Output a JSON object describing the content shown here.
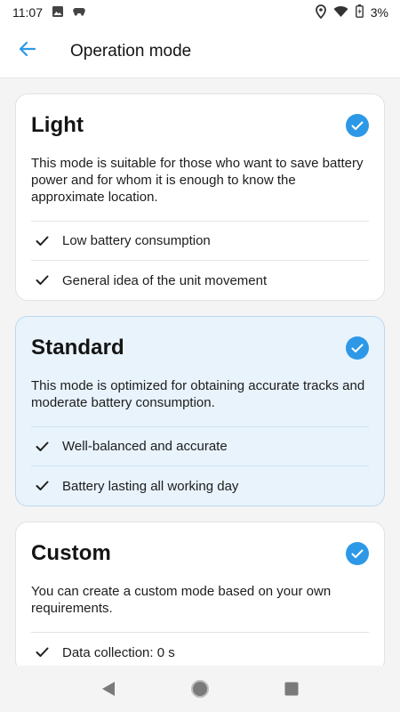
{
  "status_bar": {
    "time": "11:07",
    "battery_percent": "3%",
    "icons": [
      "image-icon",
      "game-controller-icon",
      "location-icon",
      "wifi-icon",
      "battery-icon"
    ]
  },
  "app_bar": {
    "title": "Operation mode",
    "back_icon": "arrow-left-icon"
  },
  "colors": {
    "accent": "#2d99e6",
    "selected_card_bg": "#e8f3fc"
  },
  "modes": [
    {
      "title": "Light",
      "description": "This mode is suitable for those who want to save battery power and for whom it is enough to know the approximate location.",
      "features": [
        "Low battery consumption",
        "General idea of the unit movement"
      ],
      "selected": false,
      "checked": true
    },
    {
      "title": "Standard",
      "description": "This mode is optimized for obtaining accurate tracks and moderate battery consumption.",
      "features": [
        "Well-balanced and accurate",
        "Battery lasting all working day"
      ],
      "selected": true,
      "checked": true
    },
    {
      "title": "Custom",
      "description": "You can create a custom mode based on your own requirements.",
      "features": [
        "Data collection: 0 s"
      ],
      "selected": false,
      "checked": true
    }
  ],
  "nav_bar": {
    "icons": [
      "back-triangle-icon",
      "home-circle-icon",
      "recents-square-icon"
    ]
  }
}
